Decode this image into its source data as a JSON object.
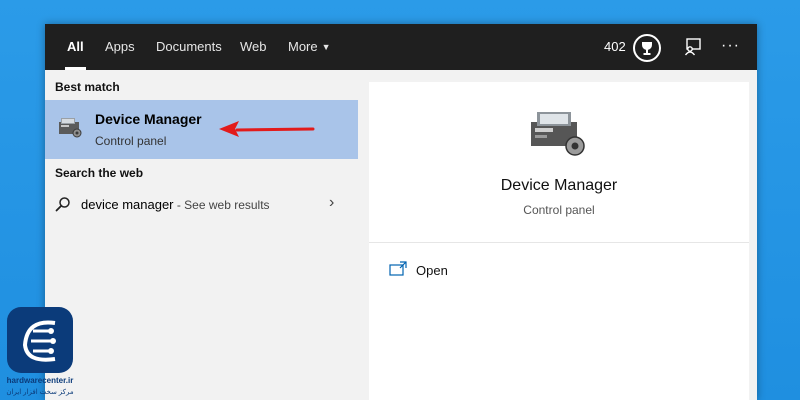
{
  "tabs": [
    {
      "label": "All",
      "active": true
    },
    {
      "label": "Apps",
      "active": false
    },
    {
      "label": "Documents",
      "active": false
    },
    {
      "label": "Web",
      "active": false
    },
    {
      "label": "More",
      "active": false
    }
  ],
  "header": {
    "points": "402",
    "more_icon": "ellipsis-icon",
    "reward_icon": "trophy-icon",
    "feedback_icon": "feedback-icon"
  },
  "best_match": {
    "section_label": "Best match",
    "title": "Device Manager",
    "subtitle": "Control panel",
    "icon": "device-manager-icon"
  },
  "web": {
    "section_label": "Search the web",
    "query": "device manager",
    "suffix": " - See web results",
    "icon": "search-icon"
  },
  "preview": {
    "title": "Device Manager",
    "subtitle": "Control panel",
    "actions": [
      {
        "label": "Open",
        "icon": "open-window-icon"
      }
    ]
  },
  "watermark": {
    "text": "hardwarecenter.ir",
    "text_fa": "مرکز سخت افزار ایران"
  },
  "colors": {
    "topbar": "#1f1f1f",
    "selection": "#a9c4e9",
    "arrow": "#e21b1b",
    "desktop": "#2b9be8"
  }
}
